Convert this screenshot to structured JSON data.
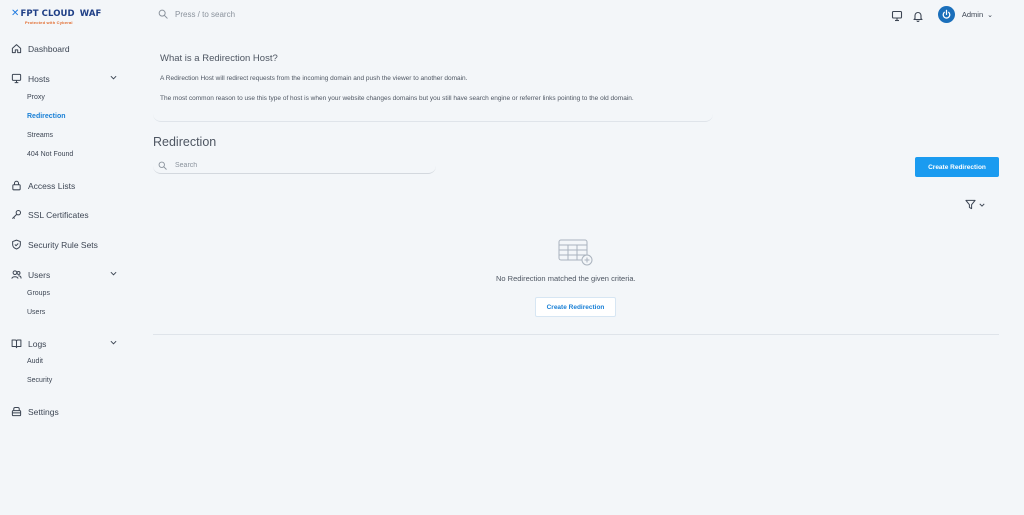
{
  "brand": {
    "name": "FPT CLOUD",
    "product": "WAF",
    "tagline": "Protected with Cyberal"
  },
  "header": {
    "search_placeholder": "Press / to search",
    "user_name": "Admin"
  },
  "sidebar": {
    "dashboard": "Dashboard",
    "hosts": "Hosts",
    "hosts_items": [
      "Proxy",
      "Redirection",
      "Streams",
      "404 Not Found"
    ],
    "access_lists": "Access Lists",
    "ssl_certificates": "SSL Certificates",
    "security_rule_sets": "Security Rule Sets",
    "users": "Users",
    "users_items": [
      "Groups",
      "Users"
    ],
    "logs": "Logs",
    "logs_items": [
      "Audit",
      "Security"
    ],
    "settings": "Settings",
    "active_item": "Redirection"
  },
  "info": {
    "title": "What is a Redirection Host?",
    "paragraph1": "A Redirection Host will redirect requests from the incoming domain and push the viewer to another domain.",
    "paragraph2": "The most common reason to use this type of host is when your website changes domains but you still have search engine or referrer links pointing to the old domain."
  },
  "main": {
    "title": "Redirection",
    "search_placeholder": "Search",
    "create_button": "Create Redirection",
    "empty_message": "No Redirection matched the given criteria.",
    "empty_create_button": "Create Redirection"
  },
  "colors": {
    "accent": "#1a9bf0",
    "active_link": "#1a80d6",
    "background": "#f3f6f9"
  }
}
